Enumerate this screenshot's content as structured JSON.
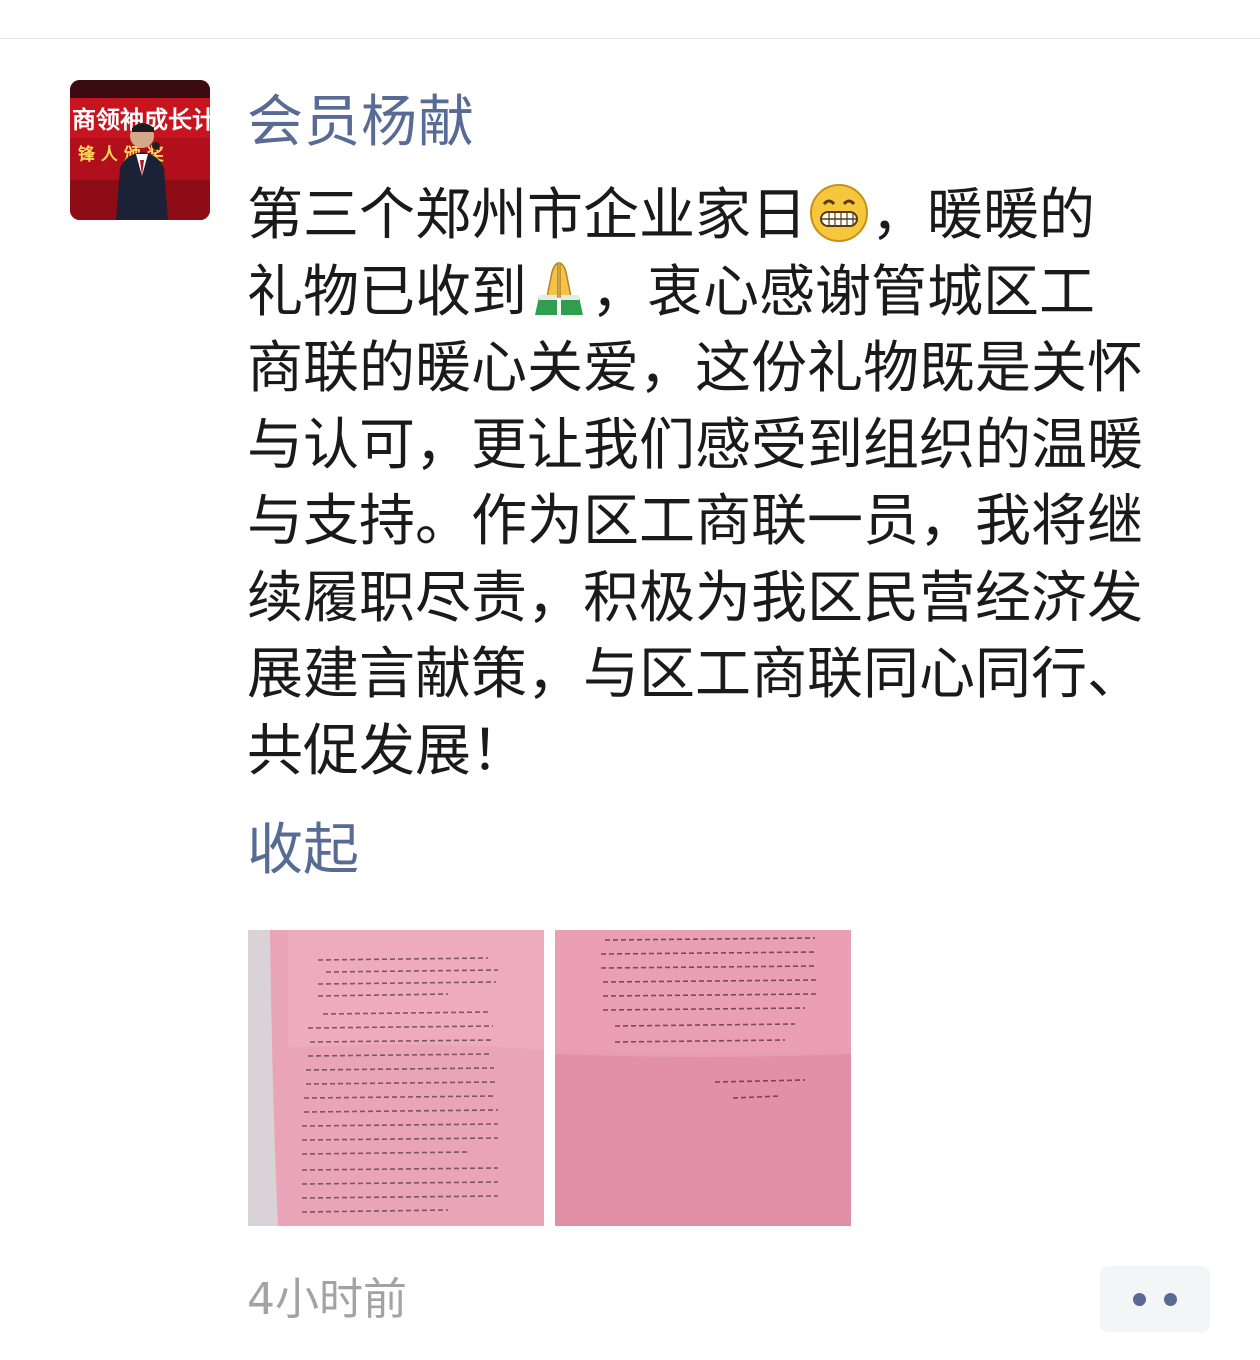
{
  "post": {
    "author": "会员杨献",
    "text_lines": [
      {
        "before": "第三个郑州市企业家日",
        "emoji": "grinning-face",
        "after": "，暖暖的"
      },
      {
        "before": "礼物已收到",
        "emoji": "folded-hands",
        "after": "，衷心感谢管城区工"
      },
      {
        "text": "商联的暖心关爱，这份礼物既是关怀"
      },
      {
        "text": "与认可，更让我们感受到组织的温暖"
      },
      {
        "text": "与支持。作为区工商联一员，我将继"
      },
      {
        "text": "续履职尽责，积极为我区民营经济发"
      },
      {
        "text": "展建言献策，与区工商联同心同行、"
      },
      {
        "text": "共促发展！"
      }
    ],
    "collapse_label": "收起",
    "timestamp": "4小时前",
    "photos": [
      {
        "icon": "letter-photo-1"
      },
      {
        "icon": "letter-photo-2"
      }
    ]
  },
  "avatar": {
    "banner_line1": "商领袖成长计",
    "banner_line2": "锋 人 颁 奖"
  },
  "colors": {
    "link": "#576b95",
    "text": "#1a1a1a",
    "timestamp": "#a3a3a3",
    "paper": "#e9aabb"
  }
}
